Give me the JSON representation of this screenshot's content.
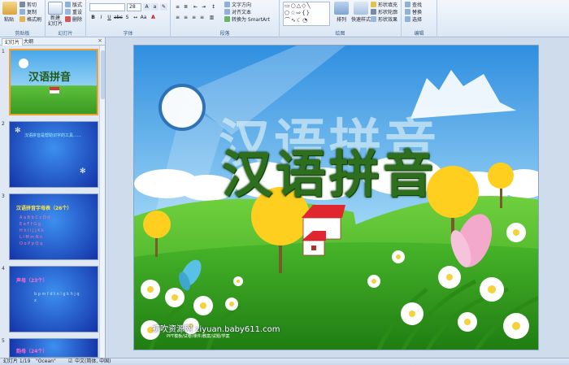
{
  "ribbon": {
    "clipboard": {
      "paste": "粘贴",
      "cut": "剪切",
      "copy": "复制",
      "format_painter": "格式刷",
      "label": "剪贴板"
    },
    "slides": {
      "new_slide": "新建\n幻灯片",
      "layout": "版式",
      "reset": "重设",
      "delete": "删除",
      "label": "幻灯片"
    },
    "font": {
      "font_name": "",
      "font_size": "28",
      "label": "字体"
    },
    "paragraph": {
      "text_direction": "文字方向",
      "align_text": "对齐文本",
      "convert_smartart": "转换为 SmartArt",
      "label": "段落"
    },
    "drawing": {
      "arrange": "排列",
      "quick_styles": "快速样式",
      "shape_fill": "形状填充",
      "shape_outline": "形状轮廓",
      "shape_effects": "形状效果",
      "label": "绘图"
    },
    "editing": {
      "find": "查找",
      "replace": "替换",
      "select": "选择",
      "label": "编辑"
    }
  },
  "left_panel": {
    "tab_slides": "幻灯片",
    "tab_outline": "大纲",
    "close": "×",
    "thumbs": [
      {
        "num": "1",
        "title": "汉语拼音"
      },
      {
        "num": "2",
        "text": "汉语拼音是帮助识字的工具……"
      },
      {
        "num": "3",
        "title": "汉语拼音字母表（26个）",
        "rows": [
          "A a B b C c D d",
          "E e F f G g",
          "H h I i J j K k",
          "L l M m N n",
          "O o P p Q q"
        ]
      },
      {
        "num": "4",
        "title": "声母（23个）"
      },
      {
        "num": "5",
        "title": "韵母（24个）"
      }
    ]
  },
  "slide": {
    "title": "汉语拼音",
    "title_shadow": "汉语拼音",
    "footer_main": "初吹资源网 ziyuan.baby611.com",
    "footer_sub": "PPT模板/试卷/课件/教案/试题/学案"
  },
  "status": {
    "slide_info": "幻灯片 1/19",
    "theme": "\"Ocean\"",
    "language": "中文(简体, 中国)"
  },
  "colors": {
    "accent": "#f0a030",
    "sky": "#3d9be6",
    "grass": "#3dab2d"
  }
}
